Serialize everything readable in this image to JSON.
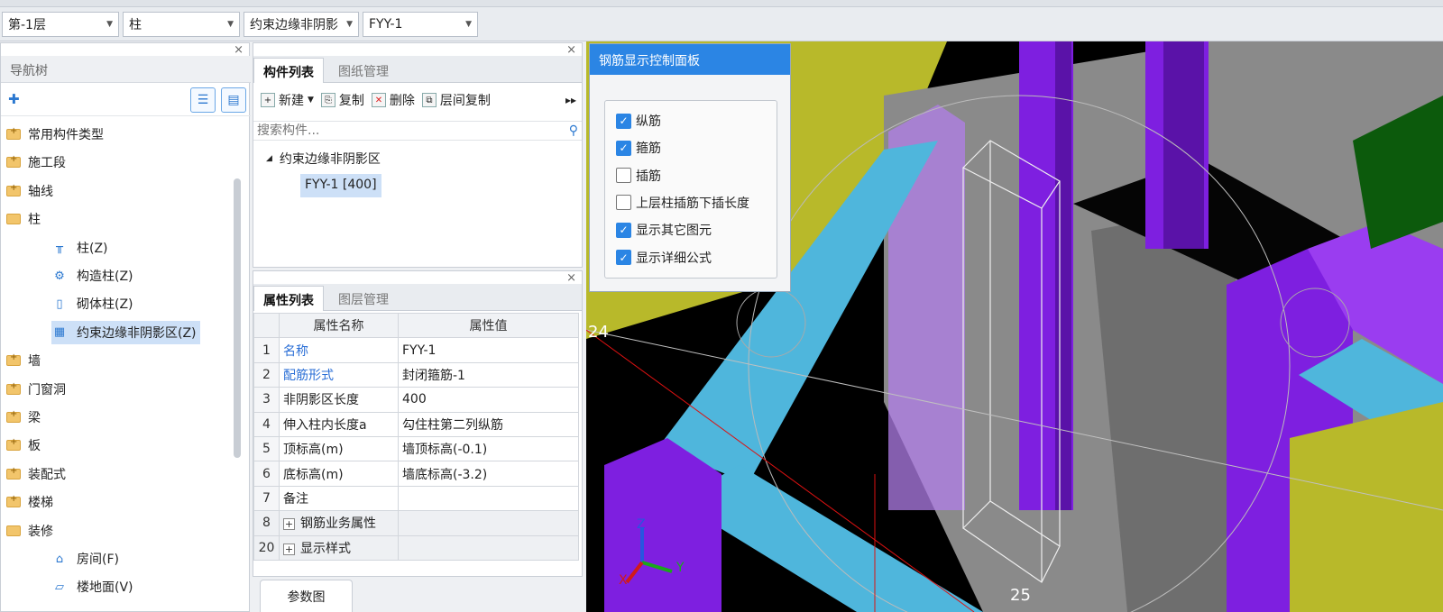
{
  "toolbar": {
    "floor": "第-1层",
    "category": "柱",
    "type": "约束边缘非阴影",
    "component": "FYY-1"
  },
  "nav": {
    "title": "导航树",
    "items": [
      {
        "label": "常用构件类型",
        "level": 0
      },
      {
        "label": "施工段",
        "level": 0
      },
      {
        "label": "轴线",
        "level": 0
      },
      {
        "label": "柱",
        "level": 0
      },
      {
        "label": "柱(Z)",
        "level": 1
      },
      {
        "label": "构造柱(Z)",
        "level": 1
      },
      {
        "label": "砌体柱(Z)",
        "level": 1
      },
      {
        "label": "约束边缘非阴影区(Z)",
        "level": 1
      },
      {
        "label": "墙",
        "level": 0
      },
      {
        "label": "门窗洞",
        "level": 0
      },
      {
        "label": "梁",
        "level": 0
      },
      {
        "label": "板",
        "level": 0
      },
      {
        "label": "装配式",
        "level": 0
      },
      {
        "label": "楼梯",
        "level": 0
      },
      {
        "label": "装修",
        "level": 0
      },
      {
        "label": "房间(F)",
        "level": 1
      },
      {
        "label": "楼地面(V)",
        "level": 1
      }
    ]
  },
  "component_panel": {
    "tabs": [
      "构件列表",
      "图纸管理"
    ],
    "actions": {
      "new": "新建",
      "copy": "复制",
      "delete": "删除",
      "floor_copy": "层间复制"
    },
    "search_placeholder": "搜索构件...",
    "group": "约束边缘非阴影区",
    "selected_item": "FYY-1 [400]"
  },
  "property_panel": {
    "tabs": [
      "属性列表",
      "图层管理"
    ],
    "columns": [
      "属性名称",
      "属性值"
    ],
    "rows": [
      {
        "num": "1",
        "name": "名称",
        "value": "FYY-1"
      },
      {
        "num": "2",
        "name": "配筋形式",
        "value": "封闭箍筋-1"
      },
      {
        "num": "3",
        "name": "非阴影区长度",
        "value": "400"
      },
      {
        "num": "4",
        "name": "伸入柱内长度a",
        "value": "勾住柱第二列纵筋"
      },
      {
        "num": "5",
        "name": "顶标高(m)",
        "value": "墙顶标高(-0.1)"
      },
      {
        "num": "6",
        "name": "底标高(m)",
        "value": "墙底标高(-3.2)"
      },
      {
        "num": "7",
        "name": "备注",
        "value": ""
      },
      {
        "num": "8",
        "name": "钢筋业务属性",
        "value": ""
      },
      {
        "num": "20",
        "name": "显示样式",
        "value": ""
      }
    ]
  },
  "bottom_tab": "参数图",
  "rebar_panel": {
    "title": "钢筋显示控制面板",
    "options": [
      {
        "label": "纵筋",
        "checked": true
      },
      {
        "label": "箍筋",
        "checked": true
      },
      {
        "label": "插筋",
        "checked": false
      },
      {
        "label": "上层柱插筋下插长度",
        "checked": false
      },
      {
        "label": "显示其它图元",
        "checked": true
      },
      {
        "label": "显示详细公式",
        "checked": true
      }
    ]
  },
  "viewport": {
    "axis_label_left": "24",
    "axis_label_bottom": "25",
    "axes": {
      "x": "X",
      "y": "Y",
      "z": "Z"
    }
  },
  "colors": {
    "accent": "#2b85e4",
    "beam": "#4fb6dc",
    "column": "#8a2be2",
    "slab": "#b8b92a",
    "wall": "#808080"
  }
}
